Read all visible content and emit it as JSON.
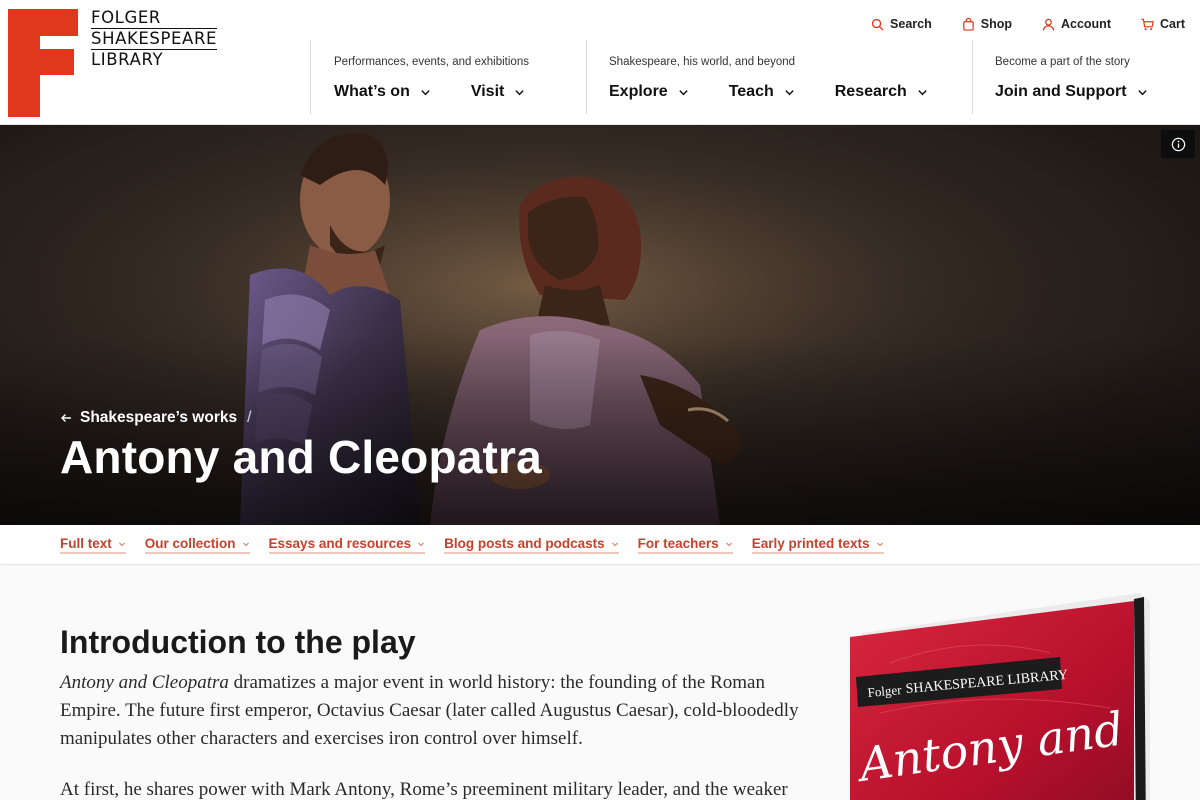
{
  "brand": {
    "name_lines": [
      "FOLGER",
      "SHAKESPEARE",
      "LIBRARY"
    ],
    "accent": "#e0381c"
  },
  "utility": [
    {
      "label": "Search",
      "icon": "search-icon"
    },
    {
      "label": "Shop",
      "icon": "shopping-bag-icon"
    },
    {
      "label": "Account",
      "icon": "user-icon"
    },
    {
      "label": "Cart",
      "icon": "cart-icon"
    }
  ],
  "nav_groups": [
    {
      "kicker": "Performances, events, and exhibitions",
      "menus": [
        "What’s on",
        "Visit"
      ]
    },
    {
      "kicker": "Shakespeare, his world, and beyond",
      "menus": [
        "Explore",
        "Teach",
        "Research"
      ]
    },
    {
      "kicker": "Become a part of the story",
      "menus": [
        "Join and Support"
      ]
    }
  ],
  "hero": {
    "breadcrumb": "Shakespeare’s works",
    "breadcrumb_separator": "/",
    "title": "Antony and Cleopatra",
    "info_icon": "info-icon"
  },
  "section_tabs": [
    "Full text",
    "Our collection",
    "Essays and resources",
    "Blog posts and podcasts",
    "For teachers",
    "Early printed texts"
  ],
  "intro": {
    "heading": "Introduction to the play",
    "p1_italic": "Antony and Cleopatra",
    "p1_rest": " dramatizes a major event in world history: the founding of the Roman Empire. The future first emperor, Octavius Caesar (later called Augustus Caesar), cold-bloodedly manipulates other characters and exercises iron control over himself.",
    "p2": "At first, he shares power with Mark Antony, Rome’s preeminent military leader, and the weaker"
  },
  "book_cover": {
    "series_label_a": "Folger",
    "series_label_b": "SHAKESPEARE LIBRARY",
    "script_title": "Antony and"
  },
  "colors": {
    "link_red": "#c8412a",
    "cover_red": "#c8102e"
  }
}
